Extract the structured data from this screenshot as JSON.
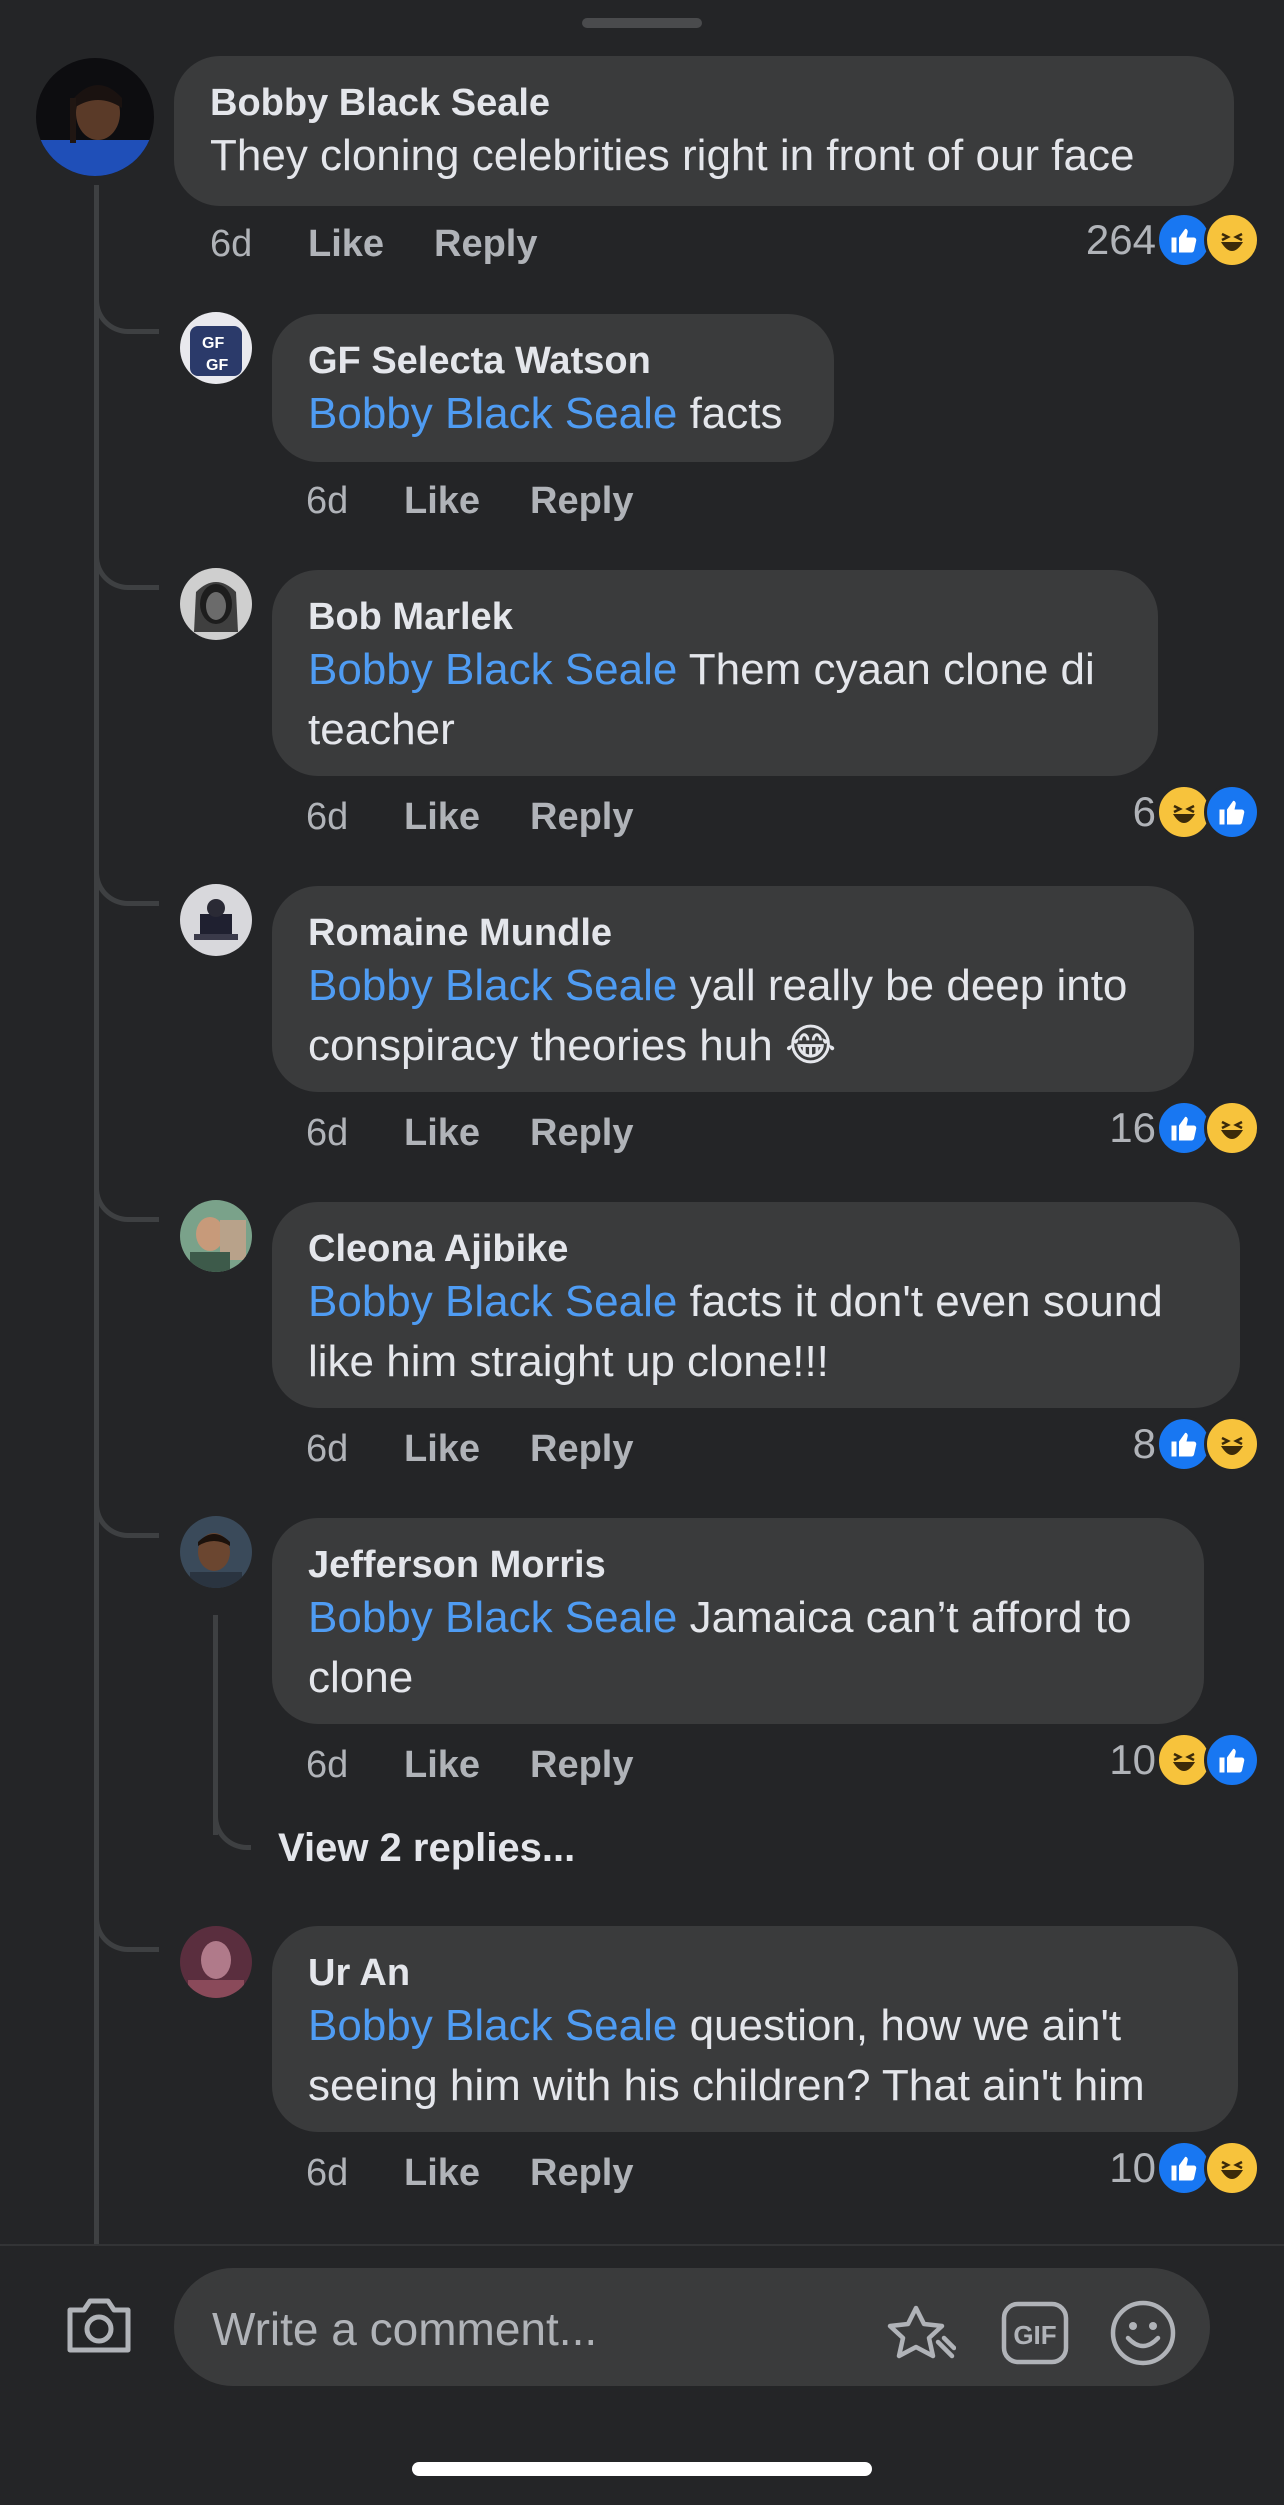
{
  "main_comment": {
    "author": "Bobby Black Seale",
    "text": "They cloning celebrities right in front of our face",
    "time": "6d",
    "like_label": "Like",
    "reply_label": "Reply",
    "reaction_count": "264",
    "reactions": [
      "like-icon",
      "haha-icon"
    ]
  },
  "replies": [
    {
      "author": "GF Selecta Watson",
      "mention": "Bobby Black Seale",
      "text": " facts",
      "time": "6d",
      "like_label": "Like",
      "reply_label": "Reply",
      "reaction_count": "",
      "reactions": []
    },
    {
      "author": "Bob Marlek",
      "mention": "Bobby Black Seale",
      "text": " Them cyaan clone di teacher",
      "time": "6d",
      "like_label": "Like",
      "reply_label": "Reply",
      "reaction_count": "6",
      "reactions": [
        "haha-icon",
        "like-icon"
      ]
    },
    {
      "author": "Romaine Mundle",
      "mention": "Bobby Black Seale",
      "text": " yall really be deep into conspiracy theories huh 😂",
      "time": "6d",
      "like_label": "Like",
      "reply_label": "Reply",
      "reaction_count": "16",
      "reactions": [
        "like-icon",
        "haha-icon"
      ]
    },
    {
      "author": "Cleona Ajibike",
      "mention": "Bobby Black Seale",
      "text": " facts it don't even sound like him straight up clone!!!",
      "time": "6d",
      "like_label": "Like",
      "reply_label": "Reply",
      "reaction_count": "8",
      "reactions": [
        "like-icon",
        "haha-icon"
      ]
    },
    {
      "author": "Jefferson Morris",
      "mention": "Bobby Black Seale",
      "text": " Jamaica can’t afford to clone",
      "time": "6d",
      "like_label": "Like",
      "reply_label": "Reply",
      "reaction_count": "10",
      "reactions": [
        "haha-icon",
        "like-icon"
      ]
    },
    {
      "author": "Ur An",
      "mention": "Bobby Black Seale",
      "text": " question, how we ain't seeing him with his children?  That ain't him",
      "time": "6d",
      "like_label": "Like",
      "reply_label": "Reply",
      "reaction_count": "10",
      "reactions": [
        "like-icon",
        "haha-icon"
      ]
    }
  ],
  "view_replies_label": "View 2 replies...",
  "composer": {
    "placeholder": "Write a comment...",
    "gif_label": "GIF",
    "icons": [
      "camera-icon",
      "sticker-icon",
      "gif-icon",
      "emoji-icon"
    ]
  },
  "colors": {
    "background": "#242527",
    "bubble": "#3a3b3c",
    "mention": "#4f9cf3",
    "like_blue": "#1877f2",
    "haha_yellow": "#f7c33c"
  }
}
